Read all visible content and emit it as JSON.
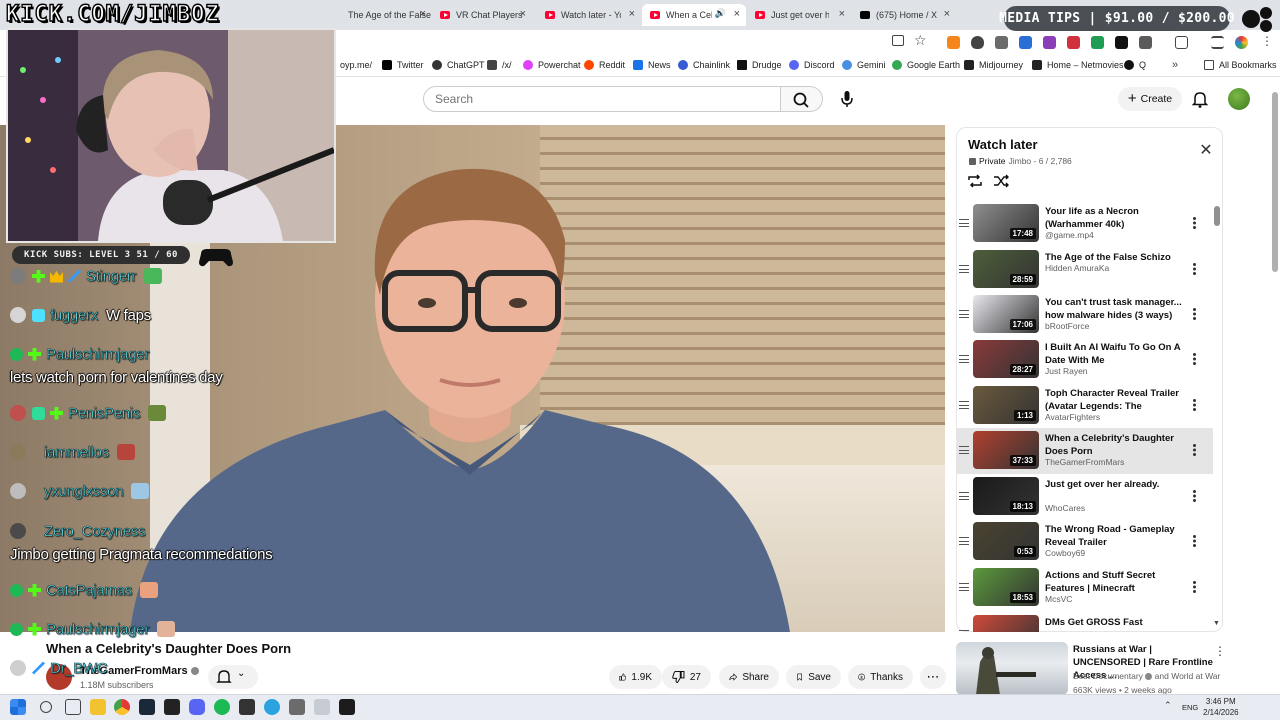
{
  "browser": {
    "tabs": [
      {
        "label": "The Age of the False Schizo",
        "icon": "youtube-icon"
      },
      {
        "label": "VR Chat Players",
        "icon": "youtube-icon"
      },
      {
        "label": "Watch later - YouTube",
        "icon": "youtube-icon"
      },
      {
        "label": "When a Celebrity's Daughter Does Porn",
        "icon": "youtube-icon",
        "active": true
      },
      {
        "label": "Just get over her already.",
        "icon": "youtube-icon"
      },
      {
        "label": "(675) Home / X",
        "icon": "x-icon"
      }
    ],
    "bookmarks": [
      {
        "label": "/biz/croyp.me"
      },
      {
        "label": "Twitter"
      },
      {
        "label": "ChatGPT"
      },
      {
        "label": "/x/"
      },
      {
        "label": "Powerchat"
      },
      {
        "label": "Reddit"
      },
      {
        "label": "News"
      },
      {
        "label": "Chainlink"
      },
      {
        "label": "Drudge"
      },
      {
        "label": "Discord"
      },
      {
        "label": "Gemini"
      },
      {
        "label": "Google Earth"
      },
      {
        "label": "Midjourney"
      },
      {
        "label": "Home – Netmovies"
      },
      {
        "label": "Q"
      }
    ],
    "all_bookmarks": "All Bookmarks"
  },
  "stream": {
    "logo_text": "KICK.COM/JIMBOZ",
    "subs_goal": "KICK SUBS: LEVEL 3 51 / 60",
    "media_tips": "MEDIA TIPS | $91.00 / $200.00"
  },
  "chat": [
    {
      "user": "Stingerr",
      "text": ""
    },
    {
      "user": "fuggerx",
      "text": "W faps"
    },
    {
      "user": "Paulschirmjager",
      "text": ""
    },
    {
      "line": "lets watch porn for valentines day"
    },
    {
      "user": "PenisPenis",
      "text": ""
    },
    {
      "user": "iammellos",
      "text": ""
    },
    {
      "user": "yxunglxsson",
      "text": ""
    },
    {
      "user": "Zero_Cozyness",
      "text": ""
    },
    {
      "line": "Jimbo getting Pragmata recommedations"
    },
    {
      "user": "CatsPajamas",
      "text": ""
    },
    {
      "user": "Paulschirmjager",
      "text": ""
    },
    {
      "user": "Dr_BWC",
      "text": ""
    }
  ],
  "youtube": {
    "search_placeholder": "Search",
    "create_label": "Create",
    "video": {
      "title": "When a Celebrity's Daughter Does Porn",
      "channel": "TheGamerFromMars",
      "subscribers": "1.18M subscribers",
      "likes": "1.9K",
      "dislikes": "27",
      "share": "Share",
      "save": "Save",
      "thanks": "Thanks"
    },
    "watch_later": {
      "title": "Watch later",
      "privacy": "Private",
      "meta": "Jimbo - 6 / 2,786",
      "items": [
        {
          "title": "Your life as a Necron (Warhammer 40k)",
          "channel": "@game.mp4",
          "duration": "17:48",
          "thumb": "#8f8f8f"
        },
        {
          "title": "The Age of the False Schizo",
          "channel": "Hidden AmuraKa",
          "duration": "28:59",
          "thumb": "#4d5f3a"
        },
        {
          "title": "You can't trust task manager... how malware hides (3 ways)",
          "channel": "bRootForce",
          "duration": "17:06",
          "thumb": "#e8e8ee"
        },
        {
          "title": "I Built An AI Waifu To Go On A Date With Me",
          "channel": "Just Rayen",
          "duration": "28:27",
          "thumb": "#8a3a3a"
        },
        {
          "title": "Toph Character Reveal Trailer (Avatar Legends: The Fightin...",
          "channel": "AvatarFighters",
          "duration": "1:13",
          "thumb": "#6b5a3d"
        },
        {
          "title": "When a Celebrity's Daughter Does Porn",
          "channel": "TheGamerFromMars",
          "duration": "37:33",
          "thumb": "#b2402e",
          "current": true
        },
        {
          "title": "Just get over her already.",
          "channel": "WhoCares",
          "duration": "18:13",
          "thumb": "#1a1a1a"
        },
        {
          "title": "The Wrong Road - Gameplay Reveal Trailer",
          "channel": "Cowboy69",
          "duration": "0:53",
          "thumb": "#4a4330"
        },
        {
          "title": "Actions and Stuff Secret Features | Minecraft Bedrock...",
          "channel": "McsVC",
          "duration": "18:53",
          "thumb": "#5c9a3c"
        },
        {
          "title": "DMs Get GROSS Fast",
          "channel": "",
          "duration": "",
          "thumb": "#d04a3a"
        }
      ]
    },
    "recommended": {
      "title": "Russians at War | UNCENSORED | Rare Frontline Access ...",
      "channel": "Best Documentary",
      "channel_suffix": "and World at War",
      "stats": "663K views • 2 weeks ago"
    }
  },
  "taskbar": {
    "lang": "ENG",
    "time": "3:46 PM",
    "date": "2/14/2026"
  }
}
